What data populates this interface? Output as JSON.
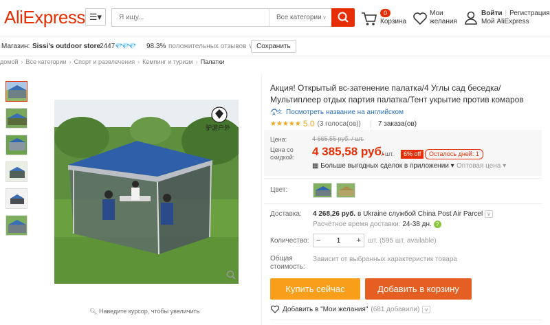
{
  "header": {
    "logo_text": "AliExpress",
    "menu_icon": "hamburger-icon",
    "search_placeholder": "Я ищу...",
    "search_category": "Все категории",
    "cart_count": "0",
    "cart_label": "Корзина",
    "wish_label_line1": "Мои",
    "wish_label_line2": "желания",
    "login": "Войти",
    "register": "Регистрация",
    "my_aliexpress": "Мой AliExpress",
    "brand_color": "#e62e04"
  },
  "store": {
    "label": "Магазин:",
    "name": "Sissi's outdoor store",
    "score": "2447",
    "diamonds": "💎💎💎",
    "positive": "98.3%",
    "positive_label": "положительных отзывов",
    "save": "Сохранить"
  },
  "breadcrumb": [
    "домой",
    "Все категории",
    "Спорт и развлечения",
    "Кемпинг и туризм",
    "Палатки"
  ],
  "gallery": {
    "zoom_hint": "Наведите курсор, чтобы увеличить",
    "logo_text": "驴游户外"
  },
  "product": {
    "title": "Акция! Открытый вс-затенение палатка/4 Углы сад беседка/Мультиплеер отдых партия палатка/Тент укрытие против комаров",
    "english_link": "Посмотреть название на английском",
    "stars": "★★★★★",
    "rating": "5.0",
    "votes": "(3 голоса(ов))",
    "orders": "7 заказа(ов)"
  },
  "price": {
    "label_price": "Цена:",
    "old_price": "4 665,55 руб. / шт.",
    "label_discount_line1": "Цена со",
    "label_discount_line2": "скидкой:",
    "new_price": "4 385,58 руб.",
    "per": "/ шт.",
    "off": "6% off",
    "days_left": "Осталось дней: 1",
    "app_deals": "Больше выгодных сделок в приложении",
    "wholesale": "Оптовая цена"
  },
  "options": {
    "color_label": "Цвет:",
    "shipping_label": "Доставка:",
    "shipping_price": "4 268,26 руб.",
    "shipping_rest": "в Ukraine службой China Post Air Parcel",
    "delivery_time_label": "Расчётное время доставки:",
    "delivery_time": "24-38 дн.",
    "qty_label": "Количество:",
    "qty_minus": "−",
    "qty_value": "1",
    "qty_plus": "+",
    "available": "шт. (595 шт. available)",
    "total_label_line1": "Общая",
    "total_label_line2": "стоимость:",
    "total_value": "Зависит от выбранных характеристик товара"
  },
  "actions": {
    "buy_now": "Купить сейчас",
    "add_to_cart": "Добавить в корзину",
    "add_wish": "Добавить в \"Мои желания\"",
    "wish_count": "(681 добавили)"
  }
}
